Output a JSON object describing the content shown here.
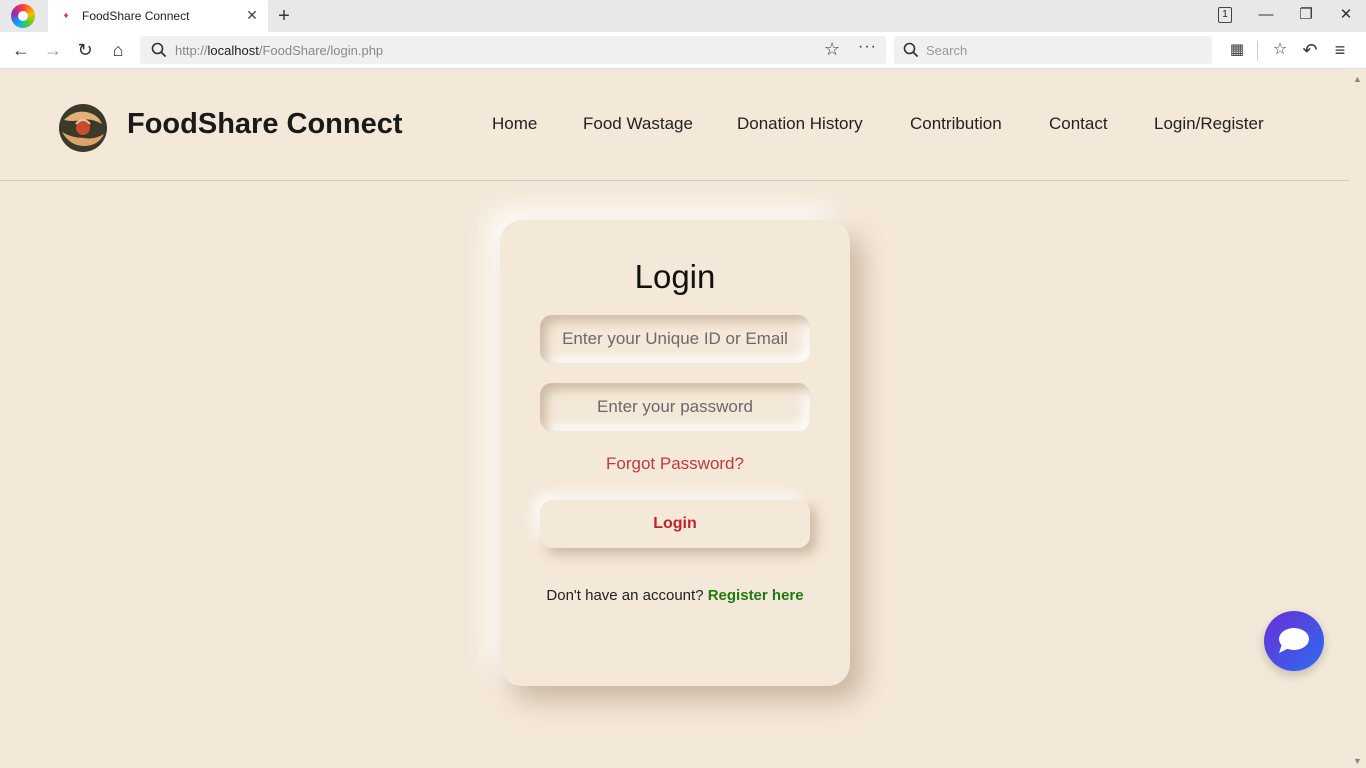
{
  "browser": {
    "tab_title": "FoodShare Connect",
    "tab_count": "1",
    "url_host": "http://",
    "url_domain": "localhost",
    "url_path": "/FoodShare/login.php",
    "search_placeholder": "Search"
  },
  "site": {
    "brand": "FoodShare Connect",
    "menu": [
      "Home",
      "Food Wastage",
      "Donation History",
      "Contribution",
      "Contact",
      "Login/Register"
    ]
  },
  "login": {
    "title": "Login",
    "id_placeholder": "Enter your Unique ID or Email",
    "password_placeholder": "Enter your password",
    "forgot": "Forgot Password?",
    "button": "Login",
    "no_account": "Don't have an account?",
    "register": "Register here"
  },
  "colors": {
    "page_bg": "#f4e8d8",
    "forgot_text": "#c0393b",
    "login_button_text": "#c0232b",
    "register_link": "#1e7b12",
    "chat_gradient_start": "#6a2fd6",
    "chat_gradient_end": "#2d6bf0"
  },
  "icons": {
    "chat": "chat-bubble-icon",
    "logo": "hands-food-logo"
  }
}
